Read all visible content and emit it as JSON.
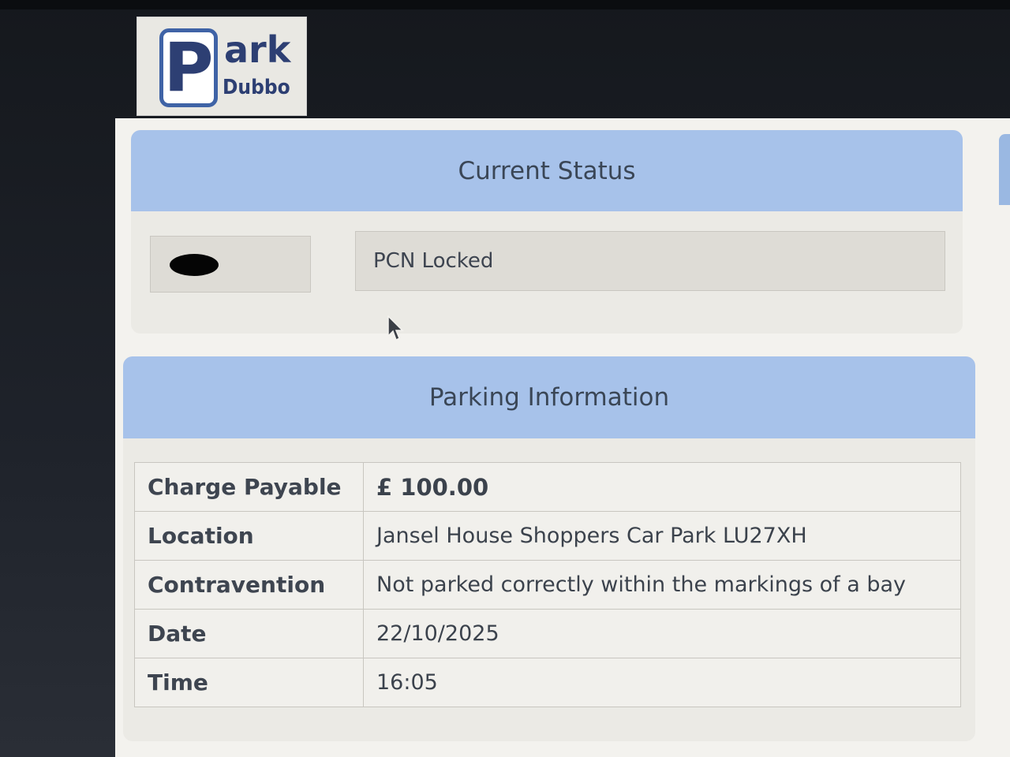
{
  "logo": {
    "p_letter": "P",
    "ark": "ark",
    "dubbo": "Dubbo"
  },
  "status": {
    "title": "Current Status",
    "value": "PCN Locked"
  },
  "parking": {
    "title": "Parking Information",
    "rows": [
      {
        "label": "Charge Payable",
        "value": "£ 100.00"
      },
      {
        "label": "Location",
        "value": "Jansel House Shoppers Car Park LU27XH"
      },
      {
        "label": "Contravention",
        "value": "Not parked correctly within the markings of a bay"
      },
      {
        "label": "Date",
        "value": "22/10/2025"
      },
      {
        "label": "Time",
        "value": "16:05"
      }
    ]
  },
  "colors": {
    "header_blue": "#a7c2ea",
    "logo_blue": "#3f63a6",
    "page_bg": "#f3f2ee"
  }
}
